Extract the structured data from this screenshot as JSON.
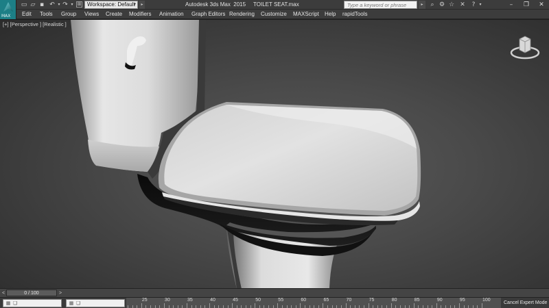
{
  "app": {
    "logo_text": "MAX",
    "window_title": "Autodesk 3ds Max  2015     TOILET SEAT.max"
  },
  "quick_access": {
    "icons": [
      "new-file-icon",
      "open-file-icon",
      "save-icon",
      "undo-icon",
      "undo-dropdown-icon",
      "redo-icon",
      "redo-dropdown-icon",
      "project-folder-icon"
    ],
    "workspace_label": "Workspace: Default"
  },
  "search": {
    "placeholder": "Type a keyword or phrase"
  },
  "title_icons": [
    "binoculars-icon",
    "subscription-center-icon",
    "star-icon",
    "close-x-icon",
    "help-icon"
  ],
  "window_controls": [
    "minimize",
    "restore",
    "close"
  ],
  "menus": [
    "Edit",
    "Tools",
    "Group",
    "Views",
    "Create",
    "Modifiers",
    "Animation",
    "Graph Editors",
    "Rendering",
    "Customize",
    "MAXScript",
    "Help",
    "rapidTools"
  ],
  "viewport": {
    "label": "[+] [Perspective ] [Realistic ]"
  },
  "timeline": {
    "frame_display": "0 / 100",
    "current_frame": 0,
    "total_frames": 100,
    "ruler_labels": [
      "25",
      "30",
      "35",
      "40",
      "45",
      "50",
      "55",
      "60",
      "65",
      "70",
      "75",
      "80",
      "85",
      "90",
      "95",
      "100"
    ]
  },
  "status": {
    "cancel_expert": "Cancel Expert Mode"
  },
  "colors": {
    "logo_teal": "#1d7f86",
    "chrome": "#3c3c3c",
    "viewport_center": "#5a5a5a"
  }
}
